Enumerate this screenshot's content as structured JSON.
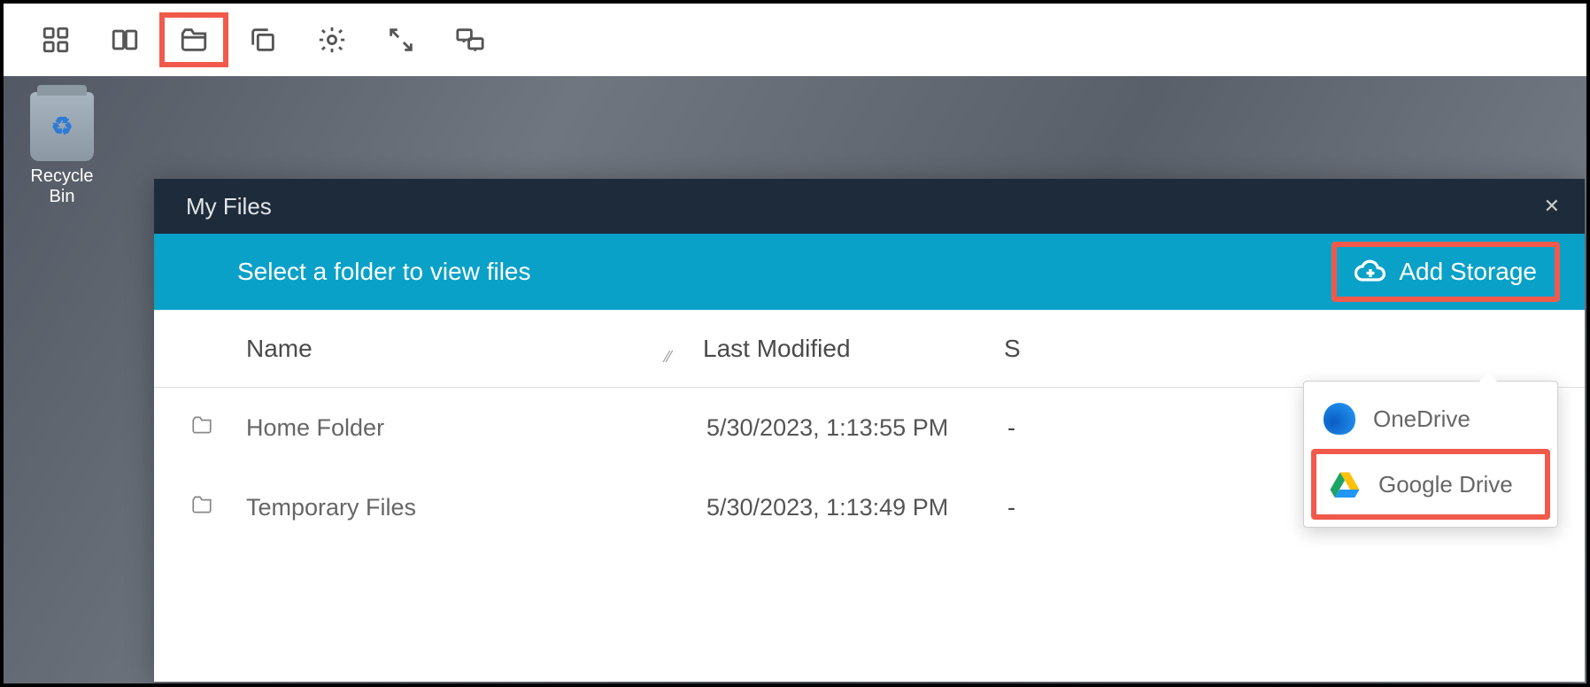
{
  "desktop": {
    "recycle_bin_label": "Recycle Bin"
  },
  "toolbar": {
    "items": [
      {
        "name": "apps-icon"
      },
      {
        "name": "windows-icon"
      },
      {
        "name": "folder-open-icon",
        "highlighted": true
      },
      {
        "name": "copy-icon"
      },
      {
        "name": "gear-icon"
      },
      {
        "name": "fullscreen-icon"
      },
      {
        "name": "displays-icon"
      }
    ]
  },
  "window": {
    "title": "My Files",
    "banner": "Select a folder to view files",
    "add_storage_label": "Add Storage",
    "columns": {
      "name": "Name",
      "modified": "Last Modified",
      "size_initial": "S"
    },
    "rows": [
      {
        "name": "Home Folder",
        "modified": "5/30/2023, 1:13:55 PM",
        "size": "-"
      },
      {
        "name": "Temporary Files",
        "modified": "5/30/2023, 1:13:49 PM",
        "size": "-"
      }
    ]
  },
  "dropdown": {
    "items": [
      {
        "label": "OneDrive",
        "icon": "onedrive-icon",
        "highlighted": false
      },
      {
        "label": "Google Drive",
        "icon": "google-drive-icon",
        "highlighted": true
      }
    ]
  }
}
